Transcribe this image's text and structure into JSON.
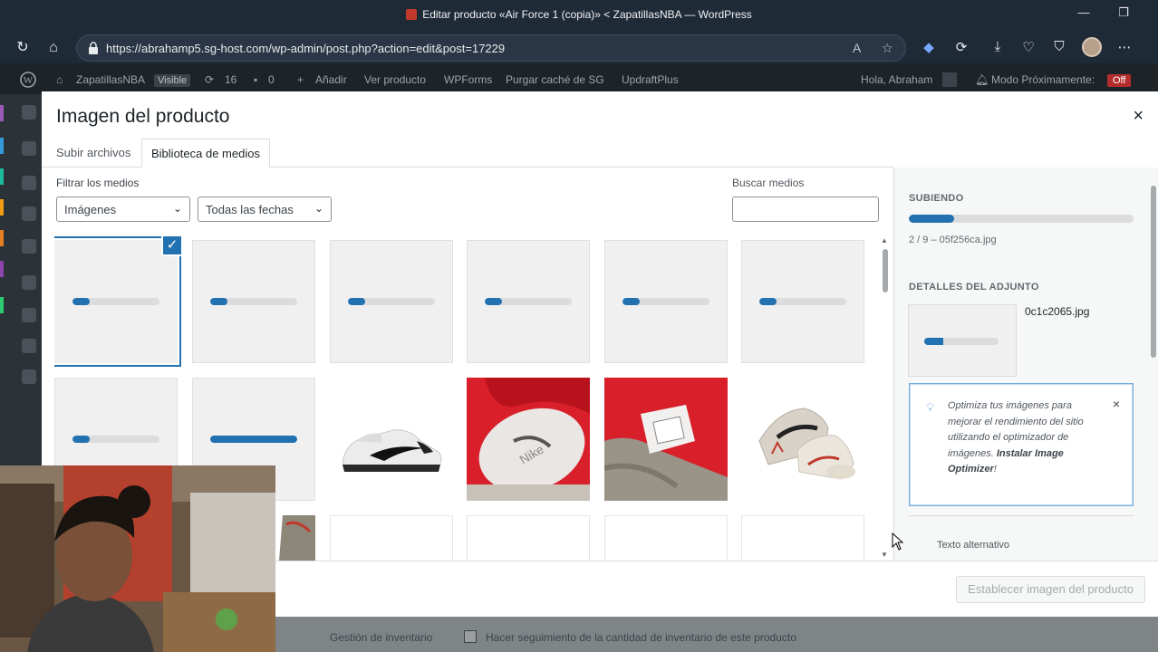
{
  "browser": {
    "window_title": "Editar producto «Air Force 1 (copia)» < ZapatillasNBA — WordPress",
    "url": "https://abrahamp5.sg-host.com/wp-admin/post.php?action=edit&post=17229",
    "icons": {
      "refresh": "↻",
      "home": "⌂",
      "read_aloud": "A",
      "favorite": "☆",
      "ext1": "◆",
      "ext2": "⟳",
      "downloads": "⤓",
      "health": "♡",
      "shield": "⛉",
      "more": "⋯",
      "minimize": "—",
      "maximize": "❐"
    }
  },
  "adminbar": {
    "site_name": "ZapatillasNBA",
    "visibility_badge": "Visible",
    "updates_count": "16",
    "comments_count": "0",
    "add_new": "Añadir",
    "view_product": "Ver producto",
    "wpforms": "WPForms",
    "purge_cache": "Purgar caché de SG",
    "updraft": "UpdraftPlus",
    "greeting": "Hola, Abraham",
    "coming_soon": "Modo Próximamente:",
    "coming_soon_state": "Off"
  },
  "modal": {
    "title": "Imagen del producto",
    "close_icon": "×",
    "tabs": [
      {
        "label": "Subir archivos"
      },
      {
        "label": "Biblioteca de medios"
      }
    ],
    "filter_label": "Filtrar los medios",
    "filter_type": "Imágenes",
    "filter_date": "Todas las fechas",
    "search_label": "Buscar medios",
    "search_value": "",
    "tiles_row1_progress": [
      0.2,
      0.2,
      0.2,
      0.2,
      0.2,
      0.2
    ],
    "tiles_row2_progress": [
      0.2,
      1.0
    ],
    "selected_check": "✓",
    "set_button": "Establecer imagen del producto"
  },
  "panel": {
    "uploading_heading": "SUBIENDO",
    "upload_progress": 0.2,
    "upload_status": "2 / 9 – 05f256ca.jpg",
    "details_heading": "DETALLES DEL ADJUNTO",
    "file_name": "0c1c2065.jpg",
    "thumb_progress": 0.25,
    "notice_text": "Optimiza tus imágenes para mejorar el rendimiento del sitio utilizando el optimizador de imágenes.",
    "notice_link": "Instalar Image Optimizer",
    "notice_suffix": "!",
    "notice_close": "×",
    "alt_label": "Texto alternativo"
  },
  "below": {
    "left_text": "Gestión de inventario",
    "checkbox_text": "Hacer seguimiento de la cantidad de inventario de este producto"
  },
  "colors": {
    "accent": "#2271b1",
    "admin_bg": "#1d2327",
    "browser_bg": "#1f2a37"
  }
}
